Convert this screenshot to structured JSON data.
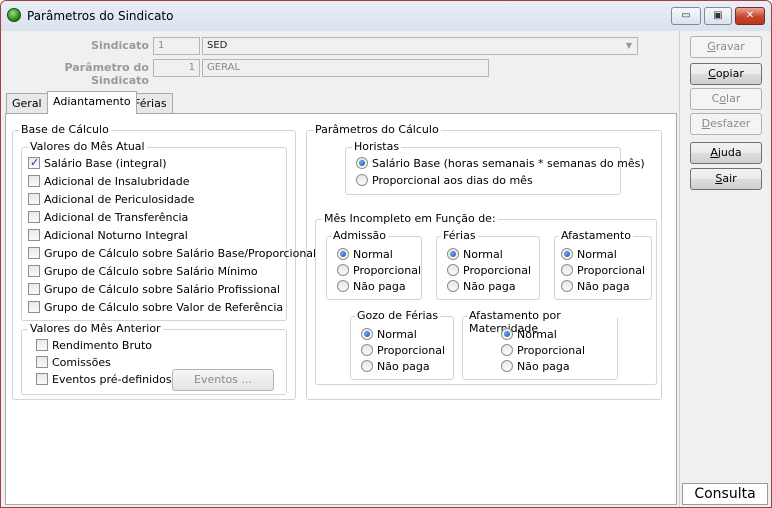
{
  "window": {
    "title": "Parâmetros do Sindicato",
    "minimize_glyph": "▭",
    "maximize_glyph": "▣",
    "close_glyph": "✕"
  },
  "header": {
    "sindicato_label": "Sindicato",
    "sindicato_code": "1",
    "sindicato_name": "SED",
    "parametro_label": "Parâmetro do Sindicato",
    "parametro_code": "1",
    "parametro_name": "GERAL"
  },
  "tabs": [
    {
      "label": "Geral"
    },
    {
      "label": "Adiantamento"
    },
    {
      "label": "Férias"
    }
  ],
  "base_calculo": {
    "title": "Base de Cálculo",
    "mes_atual": {
      "title": "Valores do Mês Atual",
      "items": [
        {
          "label": "Salário Base (integral)",
          "checked": true
        },
        {
          "label": "Adicional de Insalubridade",
          "checked": false
        },
        {
          "label": "Adicional de Periculosidade",
          "checked": false
        },
        {
          "label": "Adicional de Transferência",
          "checked": false
        },
        {
          "label": "Adicional Noturno Integral",
          "checked": false
        },
        {
          "label": "Grupo de Cálculo sobre Salário Base/Proporcional",
          "checked": false
        },
        {
          "label": "Grupo de Cálculo sobre Salário Mínimo",
          "checked": false
        },
        {
          "label": "Grupo de Cálculo sobre Salário Profissional",
          "checked": false
        },
        {
          "label": "Grupo de Cálculo sobre Valor de Referência",
          "checked": false
        }
      ]
    },
    "mes_anterior": {
      "title": "Valores do Mês Anterior",
      "items": [
        {
          "label": "Rendimento Bruto",
          "checked": false
        },
        {
          "label": "Comissões",
          "checked": false
        },
        {
          "label": "Eventos pré-definidos",
          "checked": false
        }
      ],
      "eventos_button": "Eventos ..."
    }
  },
  "parametros_calculo": {
    "title": "Parâmetros do Cálculo",
    "horistas": {
      "title": "Horistas",
      "options": [
        "Salário Base (horas semanais * semanas do mês)",
        "Proporcional aos dias do mês"
      ],
      "selected": 0
    },
    "mes_incompleto": {
      "title": "Mês Incompleto em Função de:",
      "groups": [
        {
          "title": "Admissão",
          "options": [
            "Normal",
            "Proporcional",
            "Não paga"
          ],
          "selected": 0
        },
        {
          "title": "Férias",
          "options": [
            "Normal",
            "Proporcional",
            "Não paga"
          ],
          "selected": 0
        },
        {
          "title": "Afastamento",
          "options": [
            "Normal",
            "Proporcional",
            "Não paga"
          ],
          "selected": 0
        },
        {
          "title": "Gozo de Férias",
          "options": [
            "Normal",
            "Proporcional",
            "Não paga"
          ],
          "selected": 0
        },
        {
          "title": "Afastamento por Maternidade",
          "options": [
            "Normal",
            "Proporcional",
            "Não paga"
          ],
          "selected": 0
        }
      ]
    }
  },
  "side_buttons": [
    {
      "label": "Gravar",
      "mnemonic": "G",
      "rest": "ravar",
      "enabled": false
    },
    {
      "label": "Copiar",
      "mnemonic": "C",
      "rest": "opiar",
      "enabled": true
    },
    {
      "label": "Colar",
      "mnemonic": "o",
      "pre": "C",
      "rest": "lar",
      "enabled": false
    },
    {
      "label": "Desfazer",
      "mnemonic": "D",
      "rest": "esfazer",
      "enabled": false
    },
    {
      "label": "Ajuda",
      "mnemonic": "A",
      "rest": "juda",
      "enabled": true
    },
    {
      "label": "Sair",
      "mnemonic": "S",
      "rest": "air",
      "enabled": true
    }
  ],
  "mode": "Consulta"
}
